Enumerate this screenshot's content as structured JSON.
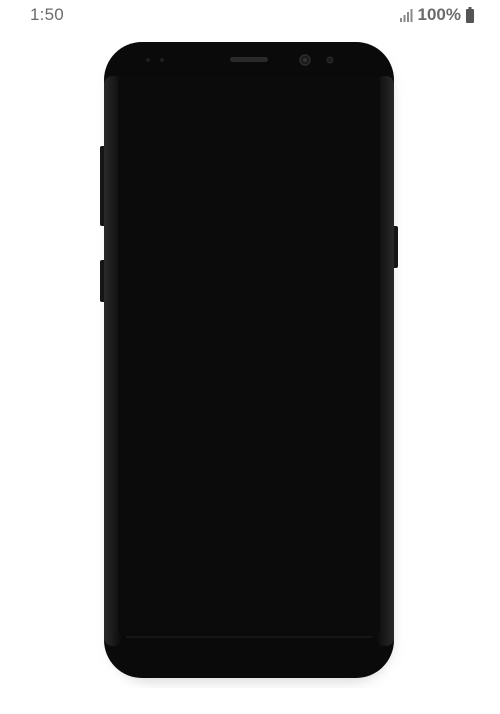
{
  "status_bar": {
    "time": "1:50",
    "battery_percent": "100%",
    "signal_icon": "signal-bars-icon",
    "battery_icon": "battery-full-icon"
  },
  "device": {
    "body_color": "#0a0a0a",
    "screen_color": "#0b0b0b",
    "shadow_color": "#cfcfcf"
  }
}
